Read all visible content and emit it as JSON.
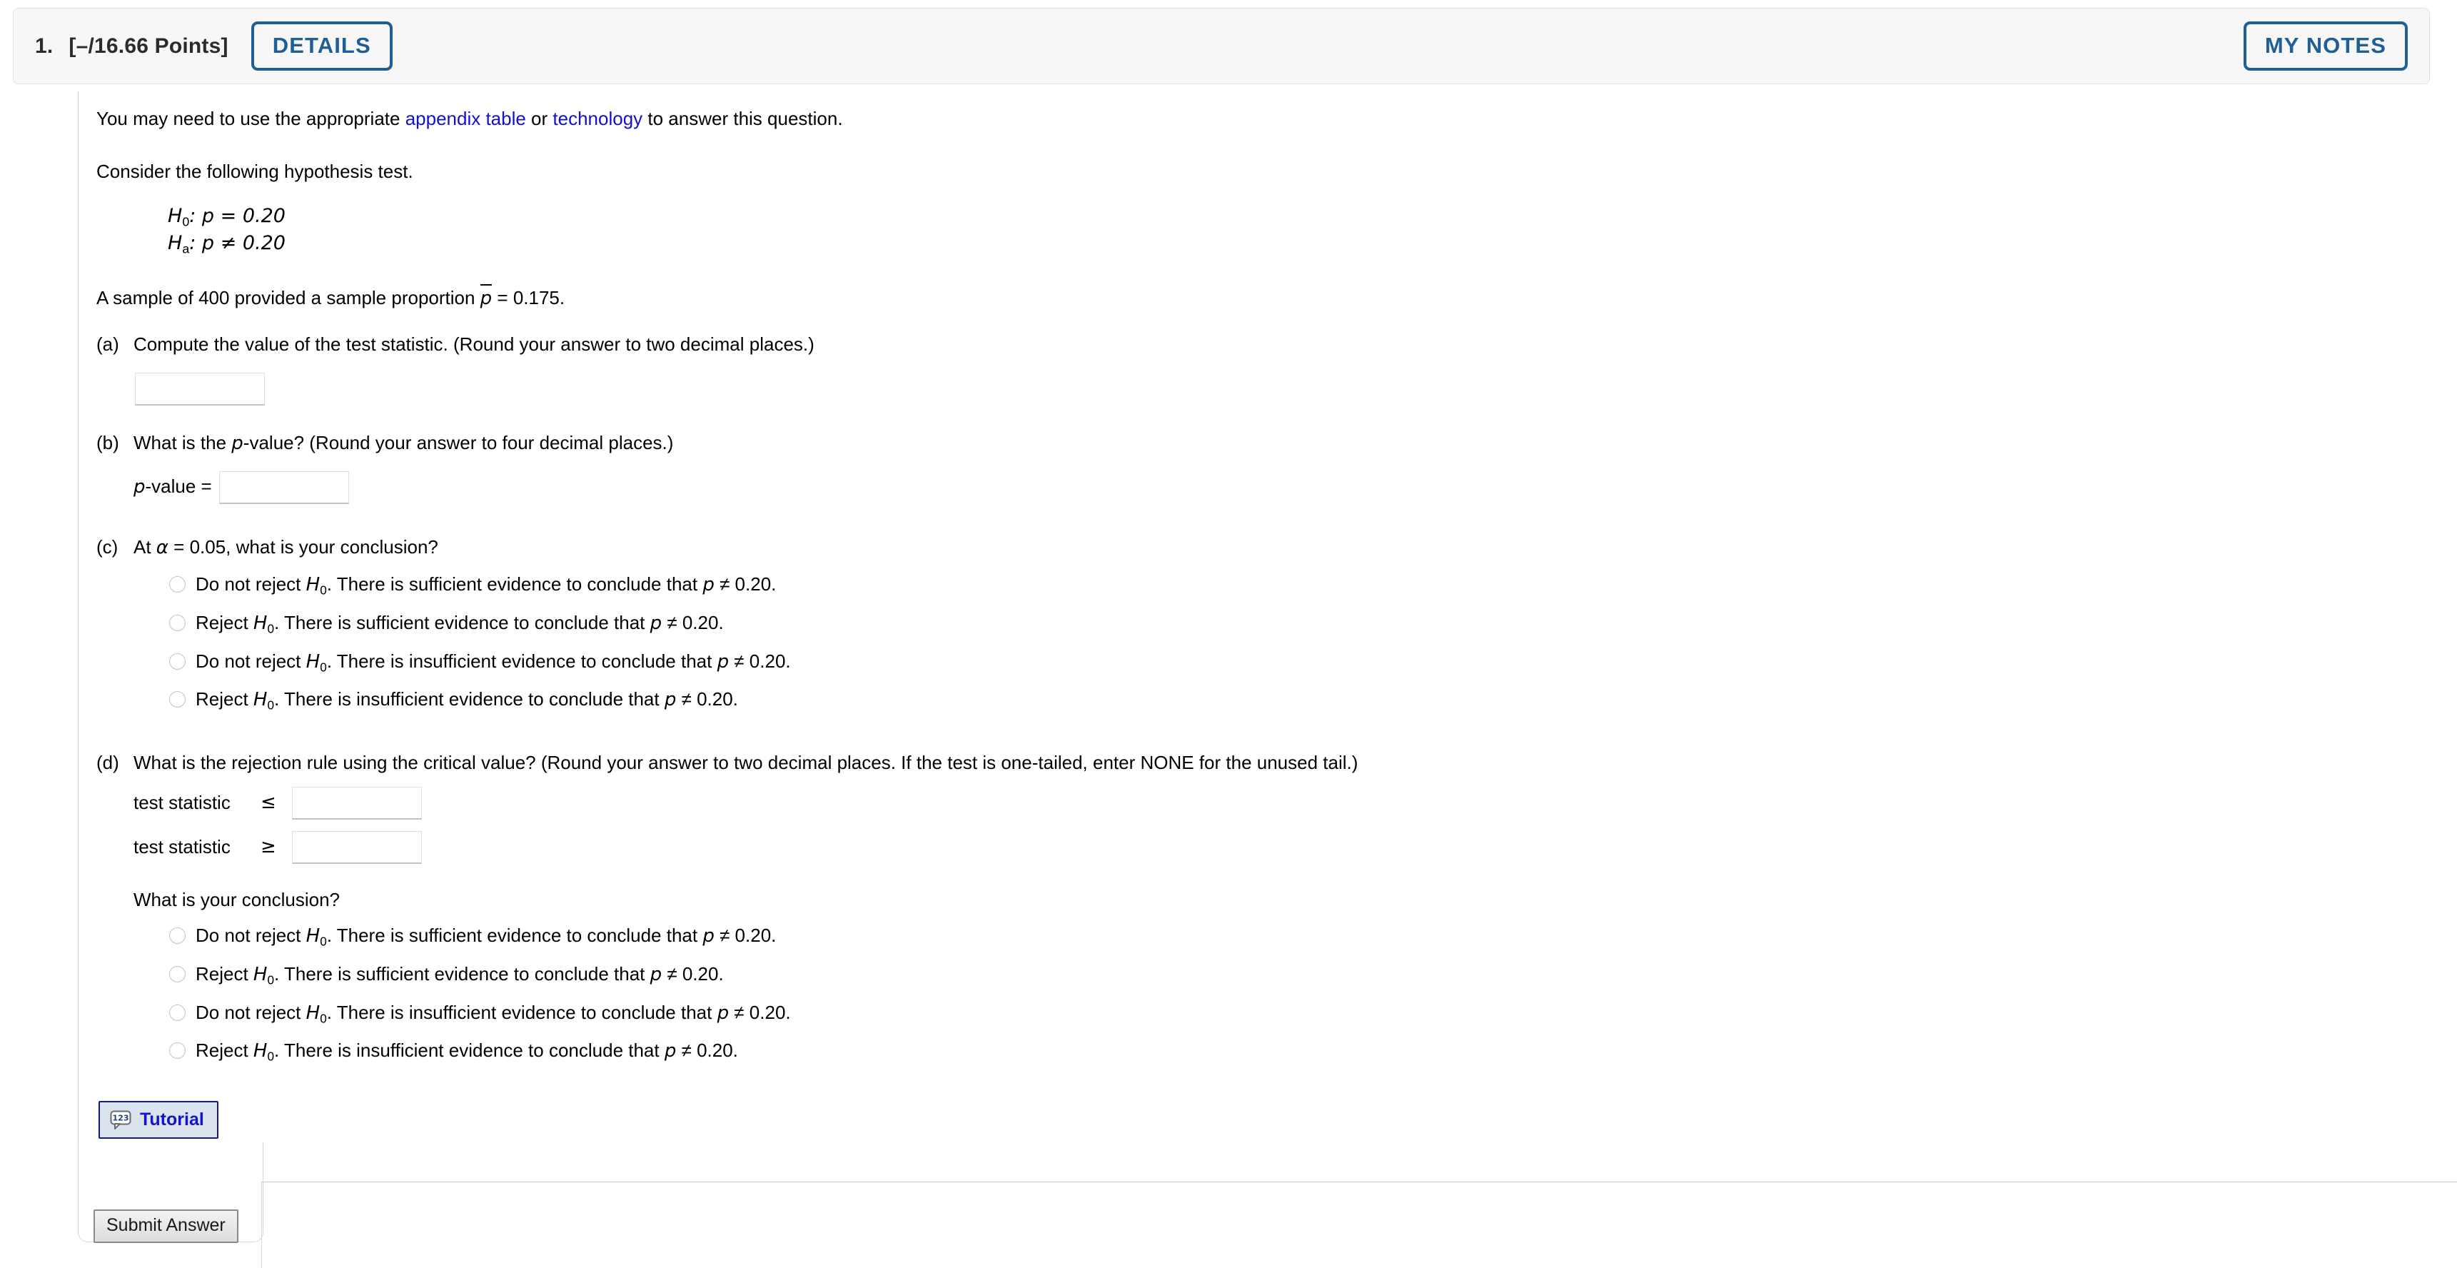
{
  "header": {
    "number": "1.",
    "points": "[–/16.66 Points]",
    "details_label": "DETAILS",
    "my_notes_label": "MY NOTES"
  },
  "intro": {
    "before_link1": "You may need to use the appropriate ",
    "link1": "appendix table",
    "between_links": " or ",
    "link2": "technology",
    "after_link2": " to answer this question.",
    "consider": "Consider the following hypothesis test."
  },
  "hypotheses": {
    "null_symbol": "H",
    "null_sub": "0",
    "null_rest": ": p = 0.20",
    "alt_symbol": "H",
    "alt_sub": "a",
    "alt_rest": ": p ≠ 0.20"
  },
  "sample": {
    "pre": "A sample of 400 provided a sample proportion ",
    "pbar": "p",
    "post": " = 0.175."
  },
  "parts": {
    "a": {
      "label": "(a)",
      "prompt": "Compute the value of the test statistic. (Round your answer to two decimal places.)",
      "input_value": ""
    },
    "b": {
      "label": "(b)",
      "prompt_pre": "What is the ",
      "prompt_var": "p",
      "prompt_post": "-value? (Round your answer to four decimal places.)",
      "field_label_var": "p",
      "field_label_rest": "-value =",
      "input_value": ""
    },
    "c": {
      "label": "(c)",
      "prompt_pre": "At ",
      "prompt_alpha": "α",
      "prompt_post": " = 0.05, what is your conclusion?",
      "options": [
        {
          "action": "Do not reject ",
          "h": "H",
          "sub": "0",
          "tail": ". There is sufficient evidence to conclude that ",
          "var": "p",
          "end": " ≠ 0.20."
        },
        {
          "action": "Reject ",
          "h": "H",
          "sub": "0",
          "tail": ". There is sufficient evidence to conclude that ",
          "var": "p",
          "end": " ≠ 0.20."
        },
        {
          "action": "Do not reject ",
          "h": "H",
          "sub": "0",
          "tail": ". There is insufficient evidence to conclude that ",
          "var": "p",
          "end": " ≠ 0.20."
        },
        {
          "action": "Reject ",
          "h": "H",
          "sub": "0",
          "tail": ". There is insufficient evidence to conclude that ",
          "var": "p",
          "end": " ≠ 0.20."
        }
      ]
    },
    "d": {
      "label": "(d)",
      "prompt": "What is the rejection rule using the critical value? (Round your answer to two decimal places. If the test is one-tailed, enter NONE for the unused tail.)",
      "row1_label": "test statistic",
      "row1_op": "≤",
      "row1_value": "",
      "row2_label": "test statistic",
      "row2_op": "≥",
      "row2_value": "",
      "conclusion_prompt": "What is your conclusion?",
      "options": [
        {
          "action": "Do not reject ",
          "h": "H",
          "sub": "0",
          "tail": ". There is sufficient evidence to conclude that ",
          "var": "p",
          "end": " ≠ 0.20."
        },
        {
          "action": "Reject ",
          "h": "H",
          "sub": "0",
          "tail": ". There is sufficient evidence to conclude that ",
          "var": "p",
          "end": " ≠ 0.20."
        },
        {
          "action": "Do not reject ",
          "h": "H",
          "sub": "0",
          "tail": ". There is insufficient evidence to conclude that ",
          "var": "p",
          "end": " ≠ 0.20."
        },
        {
          "action": "Reject ",
          "h": "H",
          "sub": "0",
          "tail": ". There is insufficient evidence to conclude that ",
          "var": "p",
          "end": " ≠ 0.20."
        }
      ]
    }
  },
  "footer": {
    "tutorial_label": "Tutorial",
    "tutorial_icon": "speech-bubble-123-icon",
    "submit_label": "Submit Answer"
  },
  "colors": {
    "link": "#1111cc",
    "accent_blue": "#1f5f96",
    "tutorial_text": "#1414c8",
    "tutorial_border": "#1a1a7a",
    "tutorial_bg": "#dbe4ee",
    "header_bg": "#f7f7f7"
  }
}
